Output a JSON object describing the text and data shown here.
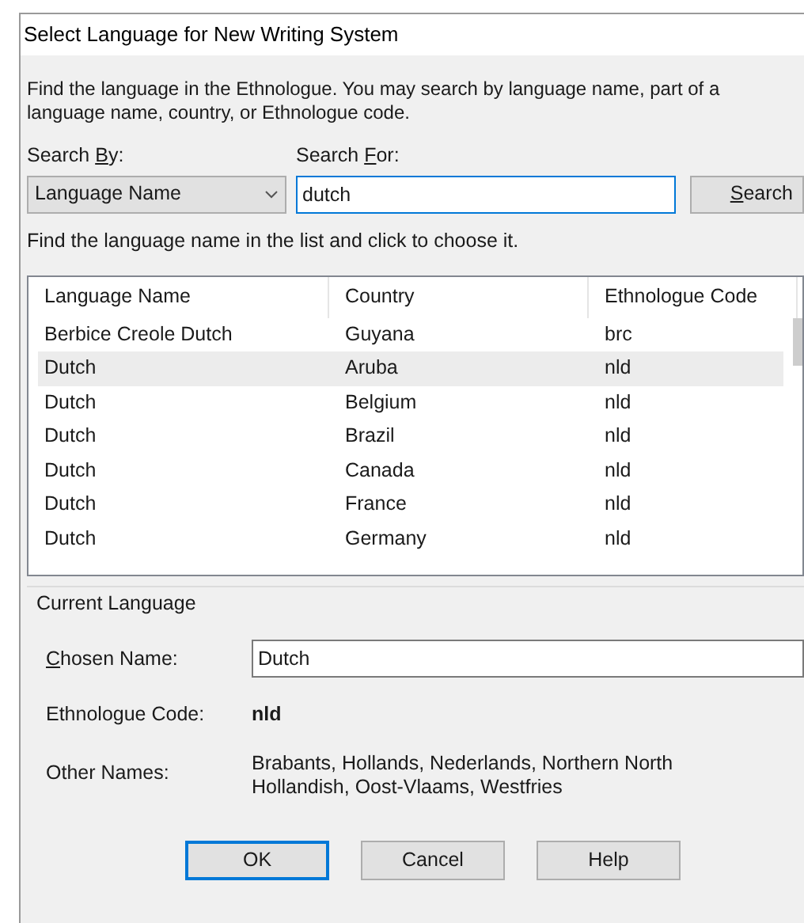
{
  "window": {
    "title": "Select Language for New Writing System"
  },
  "intro": "Find the language in the Ethnologue. You may search by language name, part of a language name, country, or Ethnologue code.",
  "search_by": {
    "label": {
      "before": "Search ",
      "key": "B",
      "after": "y:"
    },
    "value": "Language Name"
  },
  "search_for": {
    "label": {
      "before": "Search ",
      "key": "F",
      "after": "or:"
    },
    "value": "dutch"
  },
  "search_button": {
    "label": {
      "key": "S",
      "after": "earch"
    }
  },
  "list_hint": "Find the language name in the list and click to choose it.",
  "table": {
    "columns": [
      "Language Name",
      "Country",
      "Ethnologue Code"
    ],
    "rows": [
      {
        "cells": [
          "Berbice Creole Dutch",
          "Guyana",
          "brc"
        ],
        "selected": false
      },
      {
        "cells": [
          "Dutch",
          "Aruba",
          "nld"
        ],
        "selected": true
      },
      {
        "cells": [
          "Dutch",
          "Belgium",
          "nld"
        ],
        "selected": false
      },
      {
        "cells": [
          "Dutch",
          "Brazil",
          "nld"
        ],
        "selected": false
      },
      {
        "cells": [
          "Dutch",
          "Canada",
          "nld"
        ],
        "selected": false
      },
      {
        "cells": [
          "Dutch",
          "France",
          "nld"
        ],
        "selected": false
      },
      {
        "cells": [
          "Dutch",
          "Germany",
          "nld"
        ],
        "selected": false
      }
    ]
  },
  "current_language": {
    "title": "Current Language",
    "chosen_name": {
      "label": {
        "key": "C",
        "after": "hosen Name:"
      },
      "value": "Dutch"
    },
    "code": {
      "label": "Ethnologue Code:",
      "value": "nld"
    },
    "other_names": {
      "label": "Other Names:",
      "value": "Brabants, Hollands, Nederlands, Northern North Hollandish, Oost-Vlaams, Westfries"
    }
  },
  "buttons": [
    {
      "label": "OK",
      "default": true
    },
    {
      "label": "Cancel",
      "default": false
    },
    {
      "label": "Help",
      "default": false
    }
  ]
}
